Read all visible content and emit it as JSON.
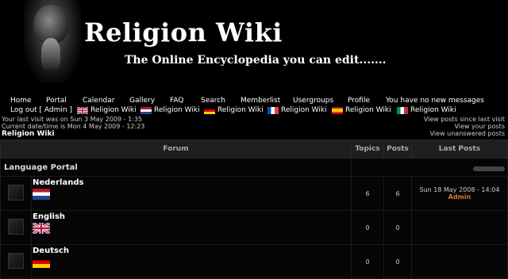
{
  "header": {
    "title": "Religion Wiki",
    "description": "The Online Encyclopedia you can edit......."
  },
  "nav": [
    "Home",
    "Portal",
    "Calendar",
    "Gallery",
    "FAQ",
    "Search",
    "Memberlist",
    "Usergroups",
    "Profile",
    "You have no new messages"
  ],
  "logout": "Log out [ Admin ]",
  "languages": [
    {
      "flag": "uk",
      "label": "Religion Wiki"
    },
    {
      "flag": "nl",
      "label": "Religion Wiki"
    },
    {
      "flag": "de",
      "label": "Religion Wiki"
    },
    {
      "flag": "fr",
      "label": "Religion Wiki"
    },
    {
      "flag": "es",
      "label": "Religion Wiki"
    },
    {
      "flag": "it",
      "label": "Religion Wiki"
    }
  ],
  "info": {
    "last_visit": "Your last visit was on Sun 3 May 2009 - 1:35",
    "current_time": "Current date/time is Mon 4 May 2009 - 12:23"
  },
  "links_right": [
    "View posts since last visit",
    "View your posts",
    "View unanswered posts"
  ],
  "breadcrumb": "Religion Wiki",
  "table": {
    "headers": {
      "forum": "Forum",
      "topics": "Topics",
      "posts": "Posts",
      "last": "Last Posts"
    },
    "category": "Language Portal",
    "forums": [
      {
        "name": "Nederlands",
        "flag": "nl",
        "topics": "6",
        "posts": "6",
        "last_date": "Sun 18 May 2008 - 14:04",
        "last_user": "Admin"
      },
      {
        "name": "English",
        "flag": "uk",
        "topics": "0",
        "posts": "0",
        "last_date": "",
        "last_user": ""
      },
      {
        "name": "Deutsch",
        "flag": "de",
        "topics": "0",
        "posts": "0",
        "last_date": "",
        "last_user": ""
      }
    ]
  }
}
